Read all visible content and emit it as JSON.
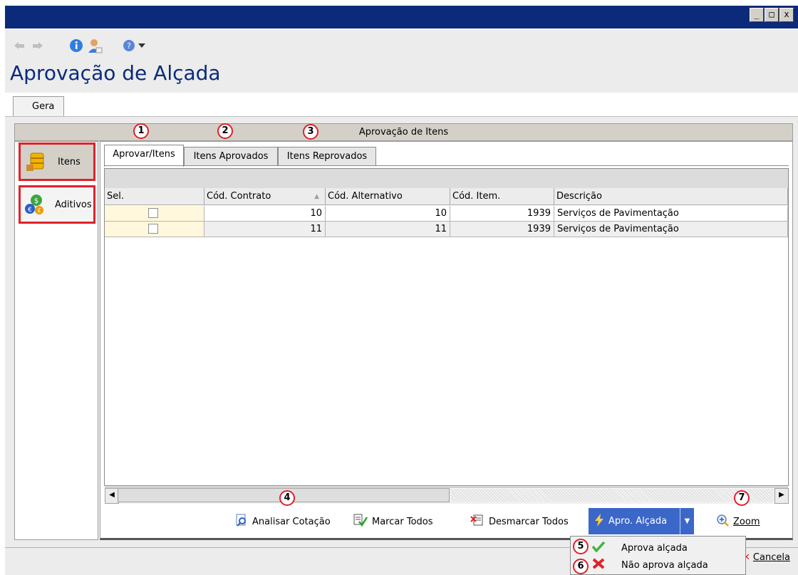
{
  "window": {
    "minimize": "_",
    "maximize": "□",
    "close": "x"
  },
  "page_title": "Aprovação de Alçada",
  "general_tab": "Gera",
  "section_header": "Aprovação de Itens",
  "sidebar": {
    "items": [
      {
        "label": "Itens"
      },
      {
        "label": "Aditivos"
      }
    ]
  },
  "tabs": [
    {
      "label": "Aprovar/Itens"
    },
    {
      "label": "Itens Aprovados"
    },
    {
      "label": "Itens Reprovados"
    }
  ],
  "table": {
    "columns": [
      "Sel.",
      "Cód. Contrato",
      "Cód. Alternativo",
      "Cód. Item.",
      "Descrição"
    ],
    "rows": [
      {
        "contrato": "10",
        "alternativo": "10",
        "item": "1939",
        "descricao": "Serviços de Pavimentação"
      },
      {
        "contrato": "11",
        "alternativo": "11",
        "item": "1939",
        "descricao": "Serviços de Pavimentação"
      }
    ]
  },
  "actions": {
    "analisar": "Analisar Cotação",
    "marcar": "Marcar Todos",
    "desmarcar": "Desmarcar Todos",
    "apro": "Apro. Alçada",
    "zoom": "Zoom"
  },
  "menu": {
    "aprova": "Aprova alçada",
    "nao_aprova": "Não aprova alçada"
  },
  "status": {
    "cancela": "Cancela"
  },
  "badges": [
    "1",
    "2",
    "3",
    "4",
    "5",
    "6",
    "7"
  ],
  "colors": {
    "title_bar": "#0b2a7a",
    "highlight": "#e0212a",
    "selected_button": "#3b67c9",
    "sel_column": "#fff8dc"
  }
}
